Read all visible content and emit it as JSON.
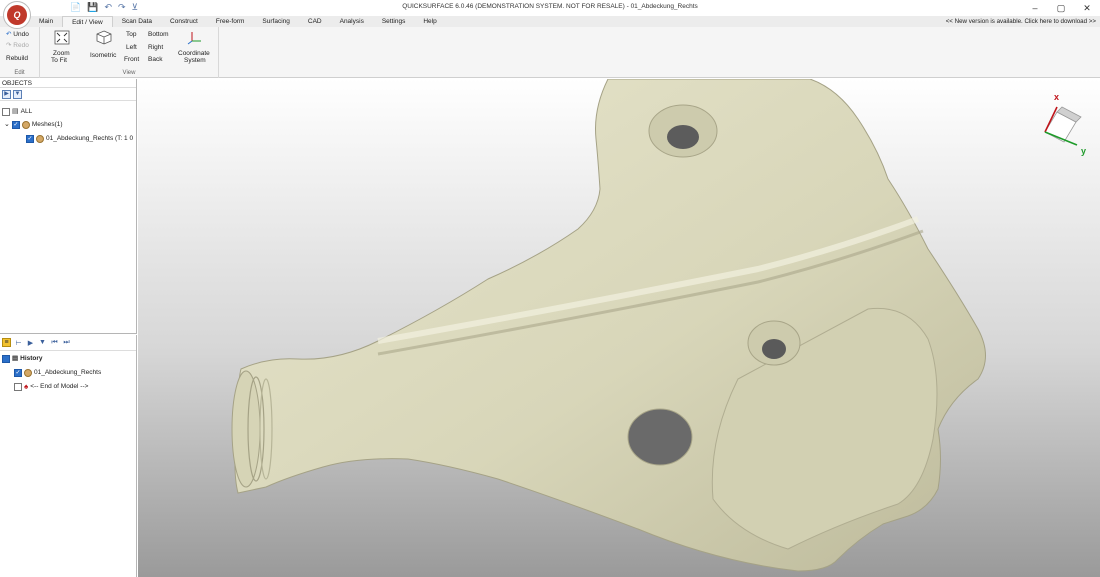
{
  "app": {
    "title": "QUICKSURFACE 6.0.46 (DEMONSTRATION SYSTEM. NOT FOR RESALE) - 01_Abdeckung_Rechts",
    "logo_text": "Q",
    "update_notice": "<< New version is available. Click here to download >>",
    "window_controls": [
      "–",
      "▢",
      "✕"
    ],
    "quick_access": [
      "📄",
      "💾",
      "↶",
      "↷",
      "⊻"
    ]
  },
  "tabs": [
    {
      "label": "Main",
      "active": false
    },
    {
      "label": "Edit / View",
      "active": true
    },
    {
      "label": "Scan Data",
      "active": false
    },
    {
      "label": "Construct",
      "active": false
    },
    {
      "label": "Free-form",
      "active": false
    },
    {
      "label": "Surfacing",
      "active": false
    },
    {
      "label": "CAD",
      "active": false
    },
    {
      "label": "Analysis",
      "active": false
    },
    {
      "label": "Settings",
      "active": false
    },
    {
      "label": "Help",
      "active": false
    }
  ],
  "ribbon": {
    "edit": {
      "undo": "Undo",
      "redo": "Redo",
      "rebuild": "Rebuild",
      "group_label": "Edit"
    },
    "view": {
      "zoom_to_fit_line1": "Zoom",
      "zoom_to_fit_line2": "To Fit",
      "isometric": "Isometric",
      "top": "Top",
      "bottom": "Bottom",
      "left": "Left",
      "right": "Right",
      "front": "Front",
      "back": "Back",
      "coordinate_system_line1": "Coordinate",
      "coordinate_system_line2": "System",
      "group_label": "View"
    }
  },
  "objects_panel": {
    "header": "OBJECTS",
    "root": "ALL",
    "meshes": "Meshes(1)",
    "mesh_item": "01_Abdeckung_Rechts (T: 1 0"
  },
  "history_panel": {
    "root": "History",
    "items": [
      "01_Abdeckung_Rechts",
      "<-- End of Model -->"
    ]
  },
  "viewport": {
    "axis_x": "x",
    "axis_y": "y",
    "part_color": "#d8d6b9",
    "background_top": "#ffffff",
    "background_bottom": "#9a9a9a",
    "axis_x_color": "#c0141a",
    "axis_y_color": "#1e9b2a"
  }
}
